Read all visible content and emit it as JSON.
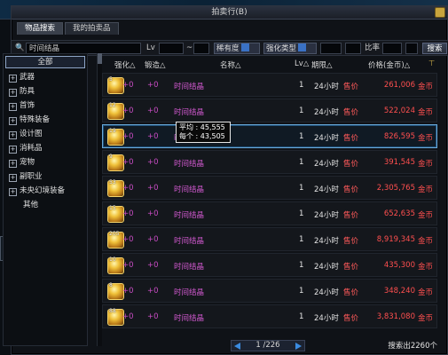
{
  "window": {
    "title": "拍卖行(B)"
  },
  "tabs": [
    {
      "label": "物品搜索",
      "active": true
    },
    {
      "label": "我的拍卖品",
      "active": false
    }
  ],
  "search": {
    "item_name": "时间结晶",
    "level_label": "Lv",
    "level_separator": "~",
    "rarity_label": "稀有度",
    "enhance_type_label": "强化类型",
    "ratio_label": "比率",
    "button_label": "搜索"
  },
  "categories": [
    {
      "label": "全部",
      "active": true,
      "expandable": false
    },
    {
      "label": "武器",
      "expandable": true
    },
    {
      "label": "防具",
      "expandable": true
    },
    {
      "label": "首饰",
      "expandable": true
    },
    {
      "label": "特殊装备",
      "expandable": true
    },
    {
      "label": "设计图",
      "expandable": true
    },
    {
      "label": "消耗品",
      "expandable": true
    },
    {
      "label": "宠物",
      "expandable": true
    },
    {
      "label": "副职业",
      "expandable": true
    },
    {
      "label": "未央幻境装备",
      "expandable": true
    },
    {
      "label": "其他",
      "expandable": false
    }
  ],
  "table": {
    "headers": {
      "enhance": "强化△",
      "forge": "锻造△",
      "name": "名称△",
      "level": "Lv△",
      "duration": "期限△",
      "price": "价格(金币)△",
      "pin": "⊤"
    },
    "rows": [
      {
        "qty": "5",
        "enhance": "+0",
        "forge": "+0",
        "name": "时间结晶",
        "level": "1",
        "duration": "24小时",
        "sale": "售价",
        "price": "261,006",
        "currency": "金币"
      },
      {
        "qty": "12",
        "enhance": "+0",
        "forge": "+0",
        "name": "时间结晶",
        "level": "1",
        "duration": "24小时",
        "sale": "售价",
        "price": "522,024",
        "currency": "金币"
      },
      {
        "qty": "19",
        "enhance": "+0",
        "forge": "+0",
        "name": "时间结晶",
        "level": "1",
        "duration": "24小时",
        "sale": "售价",
        "price": "826,595",
        "currency": "金币",
        "selected": true
      },
      {
        "qty": "9",
        "enhance": "+0",
        "forge": "+0",
        "name": "时间结晶",
        "level": "1",
        "duration": "24小时",
        "sale": "售价",
        "price": "391,545",
        "currency": "金币"
      },
      {
        "qty": "53",
        "enhance": "+0",
        "forge": "+0",
        "name": "时间结晶",
        "level": "1",
        "duration": "24小时",
        "sale": "售价",
        "price": "2,305,765",
        "currency": "金币"
      },
      {
        "qty": "15",
        "enhance": "+0",
        "forge": "+0",
        "name": "时间结晶",
        "level": "1",
        "duration": "24小时",
        "sale": "售价",
        "price": "652,635",
        "currency": "金币"
      },
      {
        "qty": "205",
        "enhance": "+0",
        "forge": "+0",
        "name": "时间结晶",
        "level": "1",
        "duration": "24小时",
        "sale": "售价",
        "price": "8,919,345",
        "currency": "金币"
      },
      {
        "qty": "10",
        "enhance": "+0",
        "forge": "+0",
        "name": "时间结晶",
        "level": "1",
        "duration": "24小时",
        "sale": "售价",
        "price": "435,300",
        "currency": "金币"
      },
      {
        "qty": "8",
        "enhance": "+0",
        "forge": "+0",
        "name": "时间结晶",
        "level": "1",
        "duration": "24小时",
        "sale": "售价",
        "price": "348,240",
        "currency": "金币"
      },
      {
        "qty": "88",
        "enhance": "+0",
        "forge": "+0",
        "name": "时间结晶",
        "level": "1",
        "duration": "24小时",
        "sale": "售价",
        "price": "3,831,080",
        "currency": "金币"
      }
    ]
  },
  "tooltip": {
    "avg_label": "平均 : 45,555",
    "each_label": "每个 : 43,505"
  },
  "pager": {
    "text": "1 /226"
  },
  "result_count": "搜索出2260个",
  "game_panel": {
    "main": "贝",
    "sub": "最近"
  },
  "colors": {
    "accent_blue": "#3a8be0",
    "price_red": "#ff4f4f",
    "name_magenta": "#d45ad2"
  }
}
